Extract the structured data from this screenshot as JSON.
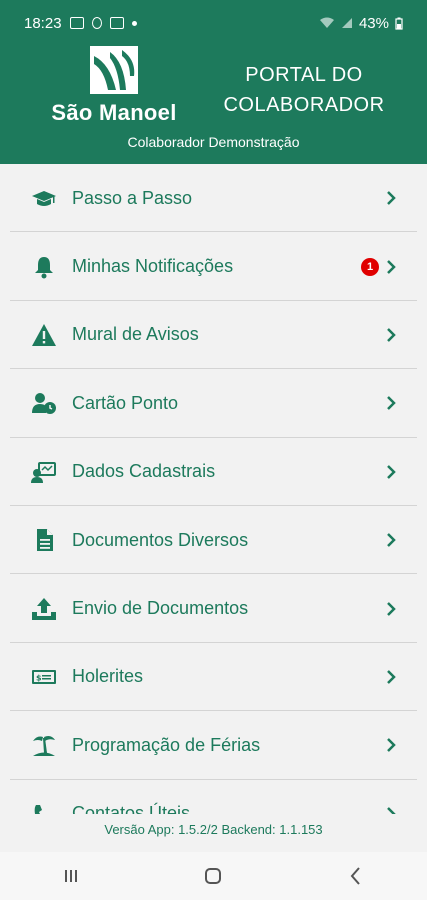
{
  "status_bar": {
    "time": "18:23",
    "battery": "43%"
  },
  "header": {
    "logo_text": "São Manoel",
    "portal_title_line1": "PORTAL DO",
    "portal_title_line2": "COLABORADOR",
    "user_name": "Colaborador Demonstração",
    "brand_color": "#1d7a5c"
  },
  "menu": {
    "items": [
      {
        "label": "Passo a Passo",
        "icon": "graduation-cap-icon"
      },
      {
        "label": "Minhas Notificações",
        "icon": "bell-icon",
        "badge": "1"
      },
      {
        "label": "Mural de Avisos",
        "icon": "warning-icon"
      },
      {
        "label": "Cartão Ponto",
        "icon": "user-clock-icon"
      },
      {
        "label": "Dados Cadastrais",
        "icon": "id-card-icon"
      },
      {
        "label": "Documentos Diversos",
        "icon": "document-icon"
      },
      {
        "label": "Envio de Documentos",
        "icon": "upload-icon"
      },
      {
        "label": "Holerites",
        "icon": "money-bill-icon"
      },
      {
        "label": "Programação de Férias",
        "icon": "palm-tree-icon"
      },
      {
        "label": "Contatos Úteis",
        "icon": "phone-icon"
      }
    ]
  },
  "footer": {
    "version": "Versão App: 1.5.2/2 Backend: 1.1.153"
  }
}
